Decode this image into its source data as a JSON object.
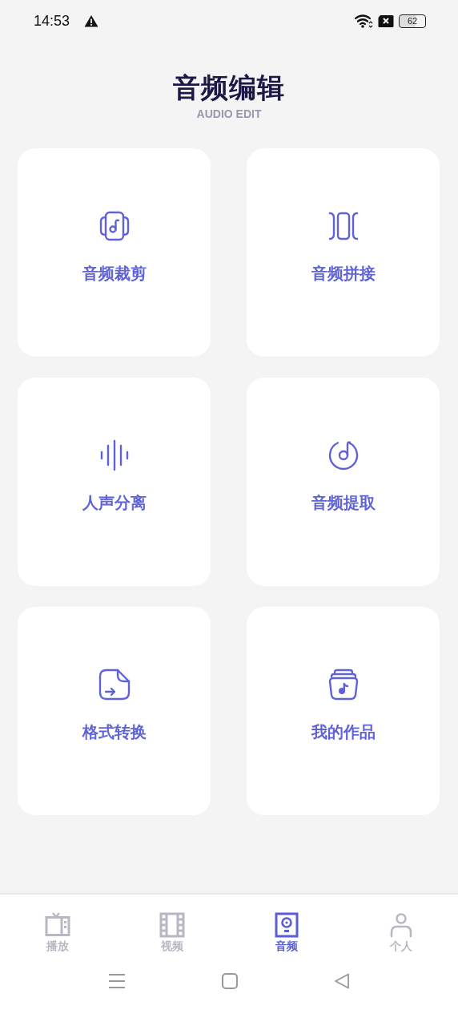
{
  "status_bar": {
    "time": "14:53",
    "battery": "62"
  },
  "header": {
    "title": "音频编辑",
    "subtitle": "AUDIO EDIT"
  },
  "tools": [
    {
      "label": "音频裁剪"
    },
    {
      "label": "音频拼接"
    },
    {
      "label": "人声分离"
    },
    {
      "label": "音频提取"
    },
    {
      "label": "格式转换"
    },
    {
      "label": "我的作品"
    }
  ],
  "tab_bar": [
    {
      "label": "播放",
      "selected": false
    },
    {
      "label": "视频",
      "selected": false
    },
    {
      "label": "音频",
      "selected": true
    },
    {
      "label": "个人",
      "selected": false
    }
  ]
}
